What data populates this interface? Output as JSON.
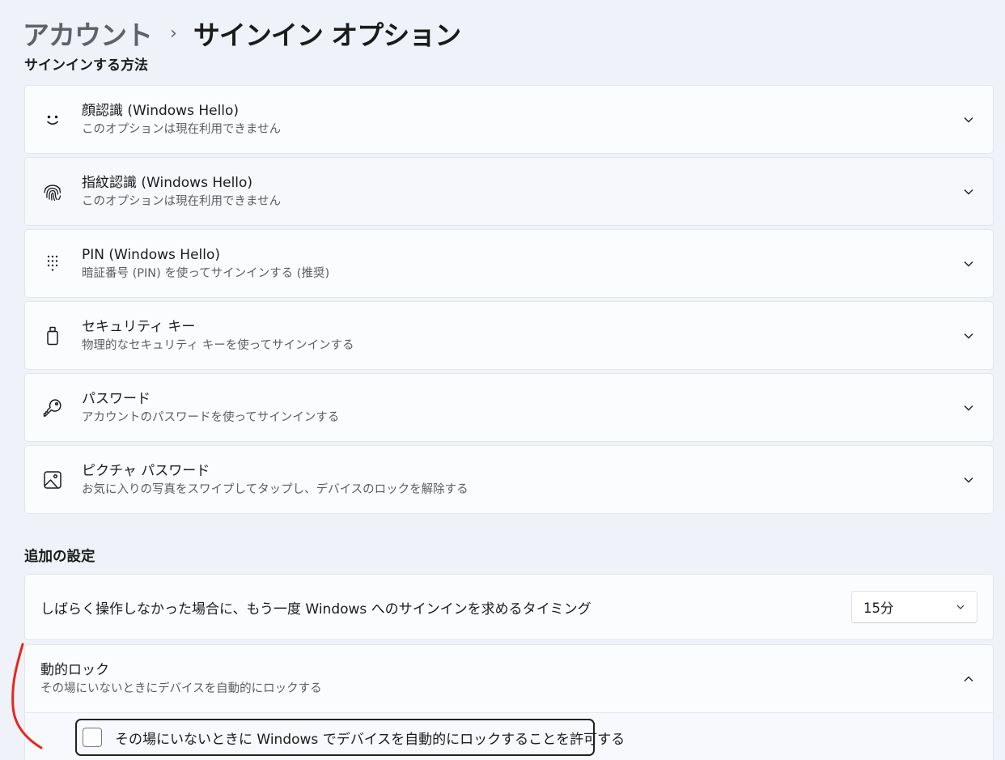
{
  "breadcrumb": {
    "parent": "アカウント",
    "separator": "›",
    "current": "サインイン オプション"
  },
  "signin_methods": {
    "section_title": "サインインする方法",
    "items": [
      {
        "icon": "face-icon",
        "title": "顔認識 (Windows Hello)",
        "subtitle": "このオプションは現在利用できません"
      },
      {
        "icon": "fingerprint-icon",
        "title": "指紋認識 (Windows Hello)",
        "subtitle": "このオプションは現在利用できません"
      },
      {
        "icon": "pin-keypad-icon",
        "title": "PIN (Windows Hello)",
        "subtitle": "暗証番号 (PIN) を使ってサインインする (推奨)"
      },
      {
        "icon": "usb-key-icon",
        "title": "セキュリティ キー",
        "subtitle": "物理的なセキュリティ キーを使ってサインインする"
      },
      {
        "icon": "key-icon",
        "title": "パスワード",
        "subtitle": "アカウントのパスワードを使ってサインインする"
      },
      {
        "icon": "picture-icon",
        "title": "ピクチャ パスワード",
        "subtitle": "お気に入りの写真をスワイプしてタップし、デバイスのロックを解除する"
      }
    ]
  },
  "additional_settings": {
    "section_title": "追加の設定",
    "timeout": {
      "label": "しばらく操作しなかった場合に、もう一度 Windows へのサインインを求めるタイミング",
      "selected": "15分"
    },
    "dynamic_lock": {
      "title": "動的ロック",
      "subtitle": "その場にいないときにデバイスを自動的にロックする",
      "expanded": true,
      "checkbox_label": "その場にいないときに Windows でデバイスを自動的にロックすることを許可する",
      "checked": false
    }
  },
  "colors": {
    "page_bg": "#eff3f9",
    "card_bg": "#fbfcfe",
    "annotation": "#e8261c"
  }
}
